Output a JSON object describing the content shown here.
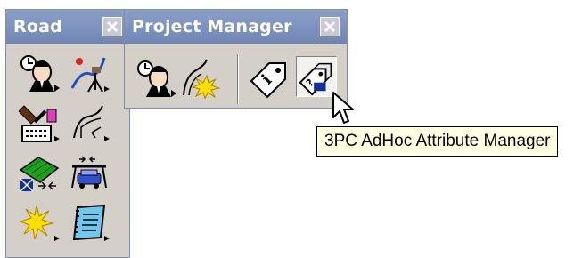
{
  "road_palette": {
    "title": "Road",
    "tools": [
      {
        "icon": "road-designer-icon"
      },
      {
        "icon": "alignment-survey-icon"
      },
      {
        "icon": "superelevation-icon"
      },
      {
        "icon": "profile-icon"
      },
      {
        "icon": "terrain-model-icon"
      },
      {
        "icon": "cross-section-icon"
      },
      {
        "icon": "sparkle-icon"
      },
      {
        "icon": "notebook-icon"
      }
    ]
  },
  "project_manager": {
    "title": "Project Manager",
    "tools": [
      {
        "icon": "project-designer-icon"
      },
      {
        "icon": "alignment-sparkle-icon"
      },
      {
        "icon": "info-tag-icon"
      },
      {
        "icon": "adhoc-attribute-icon"
      }
    ]
  },
  "tooltip": {
    "text": "3PC AdHoc Attribute Manager"
  },
  "colors": {
    "titlebar": "#7a8fbd",
    "tooltip_bg": "#ffffe1",
    "palette_bg": "#d4d0c8"
  }
}
